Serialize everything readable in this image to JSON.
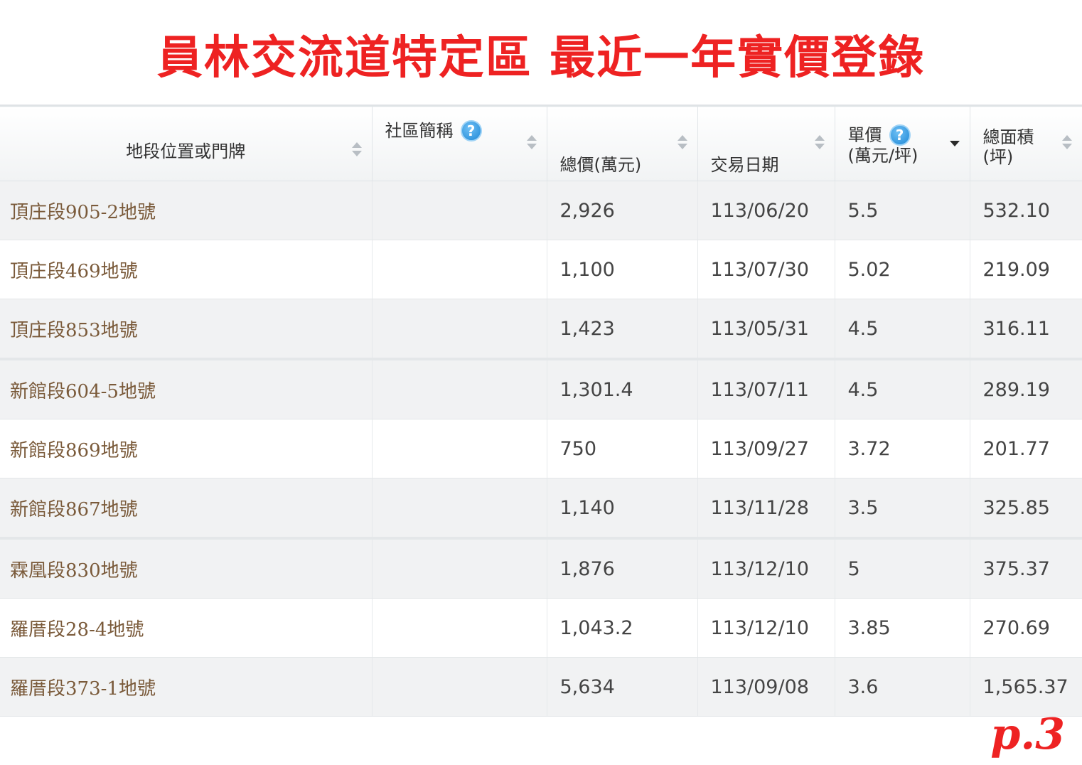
{
  "title": "員林交流道特定區 最近一年實價登錄",
  "colors": {
    "title": "#ee2222",
    "address_text": "#7a5a3a",
    "help_icon": "#1f88d6",
    "row_alt": "#f1f2f3"
  },
  "table": {
    "headers": {
      "location": "地段位置或門牌",
      "community": "社區簡稱",
      "total_price": "總價(萬元)",
      "date": "交易日期",
      "unit_price_line1": "單價",
      "unit_price_line2": "(萬元/坪)",
      "area_line1": "總面積",
      "area_line2": "(坪)"
    },
    "help_icon_glyph": "?",
    "sorted_column": "unit_price",
    "rows": [
      {
        "location": "頂庄段905-2地號",
        "community": "",
        "total_price": "2,926",
        "date": "113/06/20",
        "unit_price": "5.5",
        "area": "532.10"
      },
      {
        "location": "頂庄段469地號",
        "community": "",
        "total_price": "1,100",
        "date": "113/07/30",
        "unit_price": "5.02",
        "area": "219.09"
      },
      {
        "location": "頂庄段853地號",
        "community": "",
        "total_price": "1,423",
        "date": "113/05/31",
        "unit_price": "4.5",
        "area": "316.11"
      },
      {
        "location": "新館段604-5地號",
        "community": "",
        "total_price": "1,301.4",
        "date": "113/07/11",
        "unit_price": "4.5",
        "area": "289.19"
      },
      {
        "location": "新館段869地號",
        "community": "",
        "total_price": "750",
        "date": "113/09/27",
        "unit_price": "3.72",
        "area": "201.77"
      },
      {
        "location": "新館段867地號",
        "community": "",
        "total_price": "1,140",
        "date": "113/11/28",
        "unit_price": "3.5",
        "area": "325.85"
      },
      {
        "location": "霖凰段830地號",
        "community": "",
        "total_price": "1,876",
        "date": "113/12/10",
        "unit_price": "5",
        "area": "375.37"
      },
      {
        "location": "羅厝段28-4地號",
        "community": "",
        "total_price": "1,043.2",
        "date": "113/12/10",
        "unit_price": "3.85",
        "area": "270.69"
      },
      {
        "location": "羅厝段373-1地號",
        "community": "",
        "total_price": "5,634",
        "date": "113/09/08",
        "unit_price": "3.6",
        "area": "1,565.37"
      }
    ]
  },
  "page_number": "p.3"
}
